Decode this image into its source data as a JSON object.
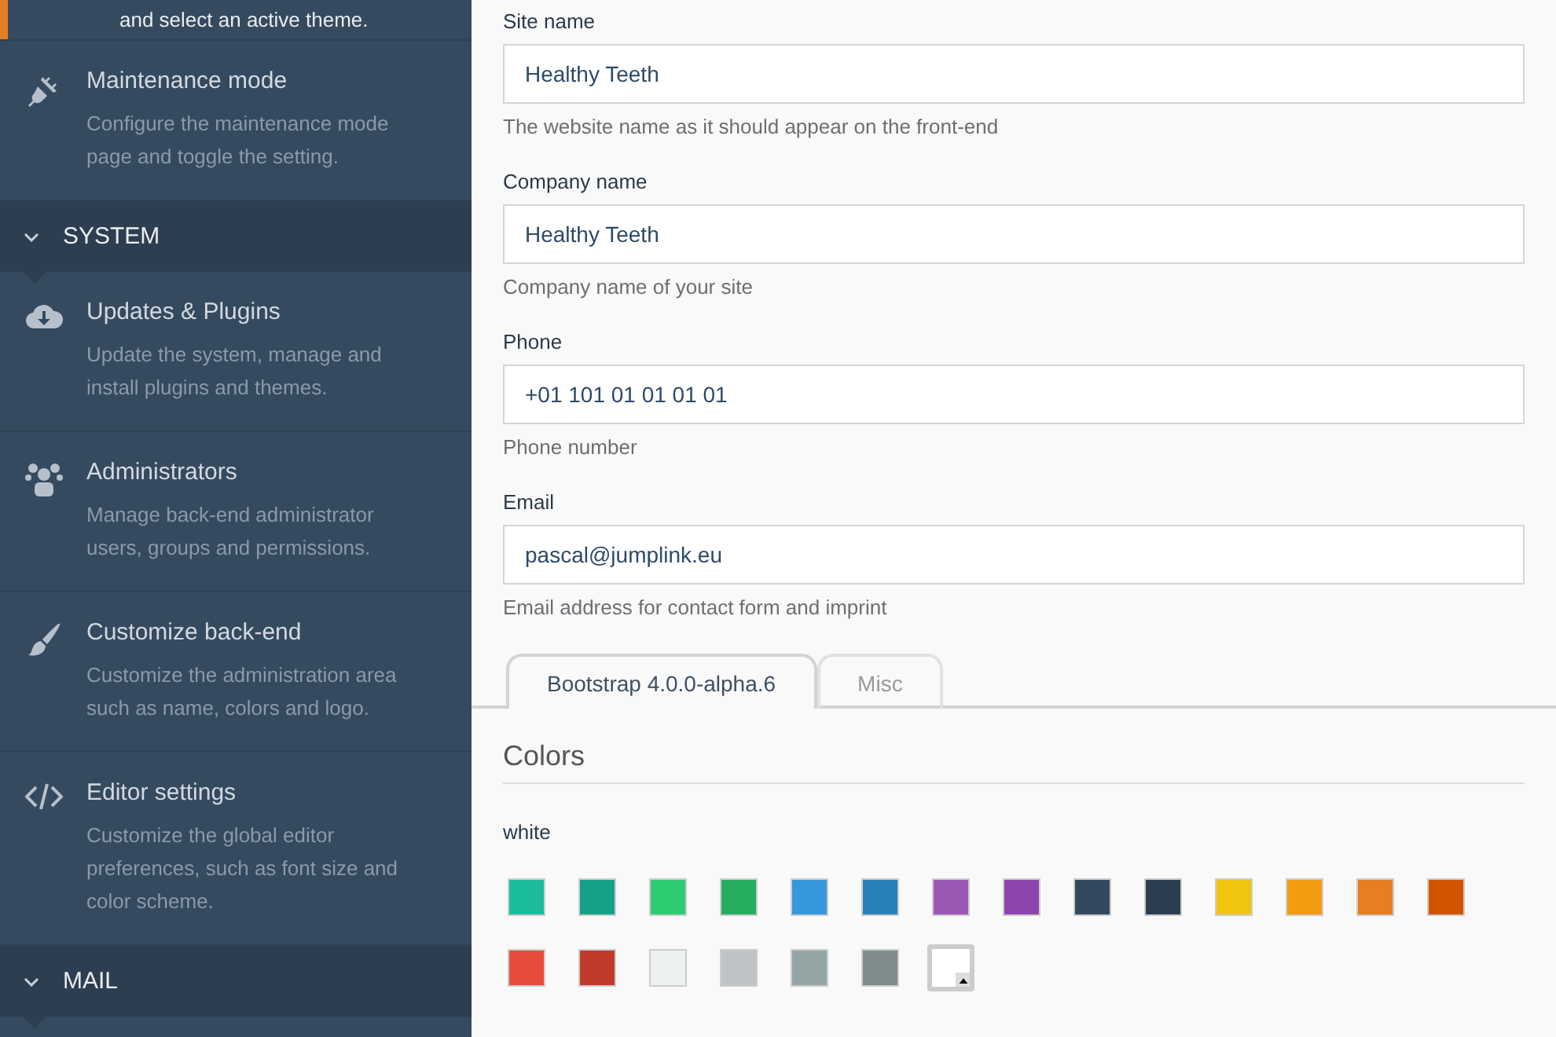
{
  "sidebar": {
    "items": [
      {
        "kind": "item",
        "description": "and select an active theme.",
        "selected": true
      },
      {
        "kind": "item",
        "title": "Maintenance mode",
        "description": "Configure the maintenance mode page and toggle the setting.",
        "selected": false
      },
      {
        "kind": "section",
        "title": "SYSTEM"
      },
      {
        "kind": "item",
        "title": "Updates & Plugins",
        "description": "Update the system, manage and install plugins and themes.",
        "selected": false
      },
      {
        "kind": "item",
        "title": "Administrators",
        "description": "Manage back-end administrator users, groups and permissions.",
        "selected": false
      },
      {
        "kind": "item",
        "title": "Customize back-end",
        "description": "Customize the administration area such as name, colors and logo.",
        "selected": false
      },
      {
        "kind": "item",
        "title": "Editor settings",
        "description": "Customize the global editor preferences, such as font size and color scheme.",
        "selected": false
      },
      {
        "kind": "section",
        "title": "MAIL"
      }
    ]
  },
  "form": {
    "fields": [
      {
        "label": "Site name",
        "value": "Healthy Teeth",
        "help": "The website name as it should appear on the front-end"
      },
      {
        "label": "Company name",
        "value": "Healthy Teeth",
        "help": "Company name of your site"
      },
      {
        "label": "Phone",
        "value": "+01 101 01 01 01 01",
        "help": "Phone number"
      },
      {
        "label": "Email",
        "value": "pascal@jumplink.eu",
        "help": "Email address for contact form and imprint"
      }
    ]
  },
  "tabs": [
    {
      "label": "Bootstrap 4.0.0-alpha.6",
      "selected": true
    },
    {
      "label": "Misc",
      "selected": false
    }
  ],
  "colors": {
    "heading": "Colors",
    "label": "white",
    "swatches": [
      {
        "color": "#1abc9c",
        "selected": false
      },
      {
        "color": "#16a085",
        "selected": false
      },
      {
        "color": "#2ecc71",
        "selected": false
      },
      {
        "color": "#27ae60",
        "selected": false
      },
      {
        "color": "#3498db",
        "selected": false
      },
      {
        "color": "#2980b9",
        "selected": false
      },
      {
        "color": "#9b59b6",
        "selected": false
      },
      {
        "color": "#8e44ad",
        "selected": false
      },
      {
        "color": "#34495e",
        "selected": false
      },
      {
        "color": "#2c3e50",
        "selected": false
      },
      {
        "color": "#f1c40f",
        "selected": false
      },
      {
        "color": "#f39c12",
        "selected": false
      },
      {
        "color": "#e67e22",
        "selected": false
      },
      {
        "color": "#d35400",
        "selected": false
      },
      {
        "color": "#e74c3c",
        "selected": false
      },
      {
        "color": "#c0392b",
        "selected": false
      },
      {
        "color": "#ecf0f1",
        "selected": false
      },
      {
        "color": "#bdc3c7",
        "selected": false
      },
      {
        "color": "#95a5a6",
        "selected": false
      },
      {
        "color": "#7f8c8d",
        "selected": false
      },
      {
        "color": "#ffffff",
        "selected": true
      }
    ]
  }
}
